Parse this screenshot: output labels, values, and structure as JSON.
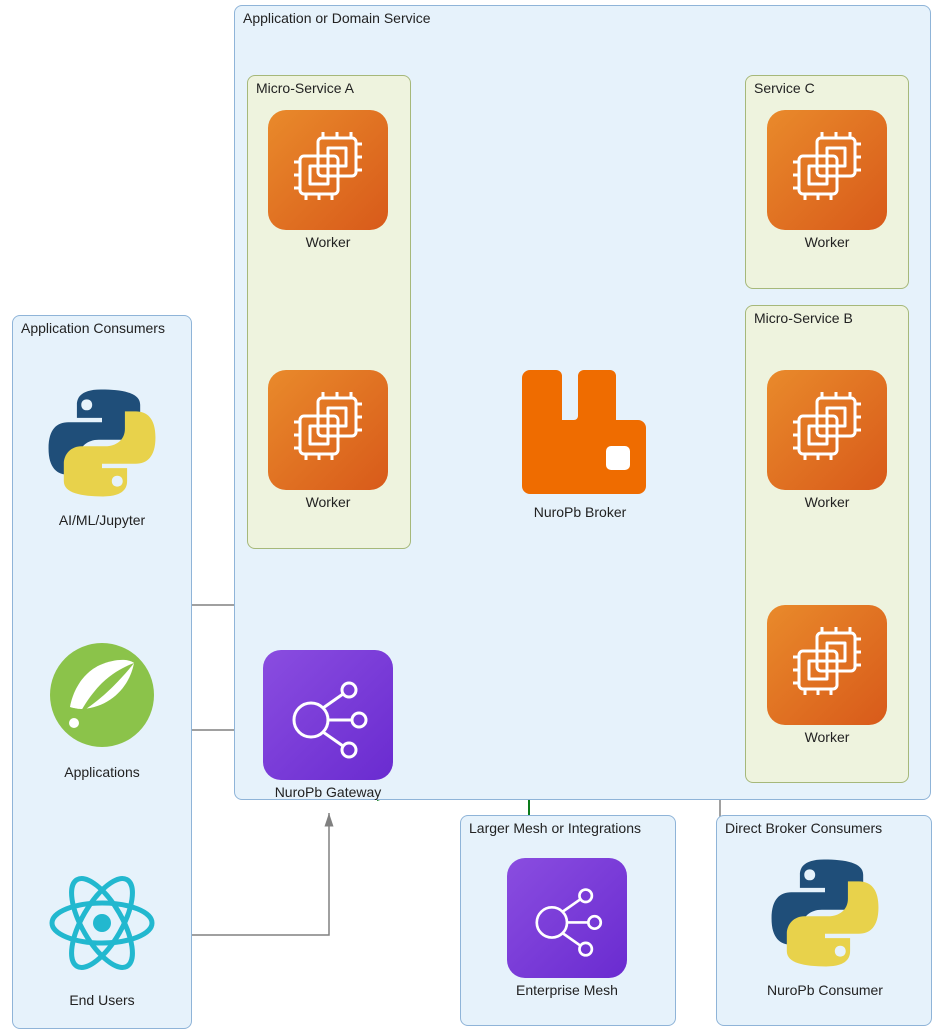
{
  "domain_title": "Application or Domain Service",
  "consumers_title": "Application Consumers",
  "microA_title": "Micro-Service A",
  "microB_title": "Micro-Service B",
  "serviceC_title": "Service C",
  "mesh_title": "Larger Mesh or Integrations",
  "direct_title": "Direct Broker Consumers",
  "workerA1_label": "Worker",
  "workerA2_label": "Worker",
  "workerB1_label": "Worker",
  "workerB2_label": "Worker",
  "workerC_label": "Worker",
  "broker_label": "NuroPb Broker",
  "gateway_label": "NuroPb Gateway",
  "mesh_label": "Enterprise Mesh",
  "consumer_python_label": "NuroPb Consumer",
  "jupyter_label": "AI/ML/Jupyter",
  "applications_label": "Applications",
  "endusers_label": "End Users",
  "colors": {
    "orange": "#d85a1a",
    "purple": "#6a2bd0",
    "green_arrow": "#0a7a1a",
    "gray_arrow": "#808080"
  }
}
